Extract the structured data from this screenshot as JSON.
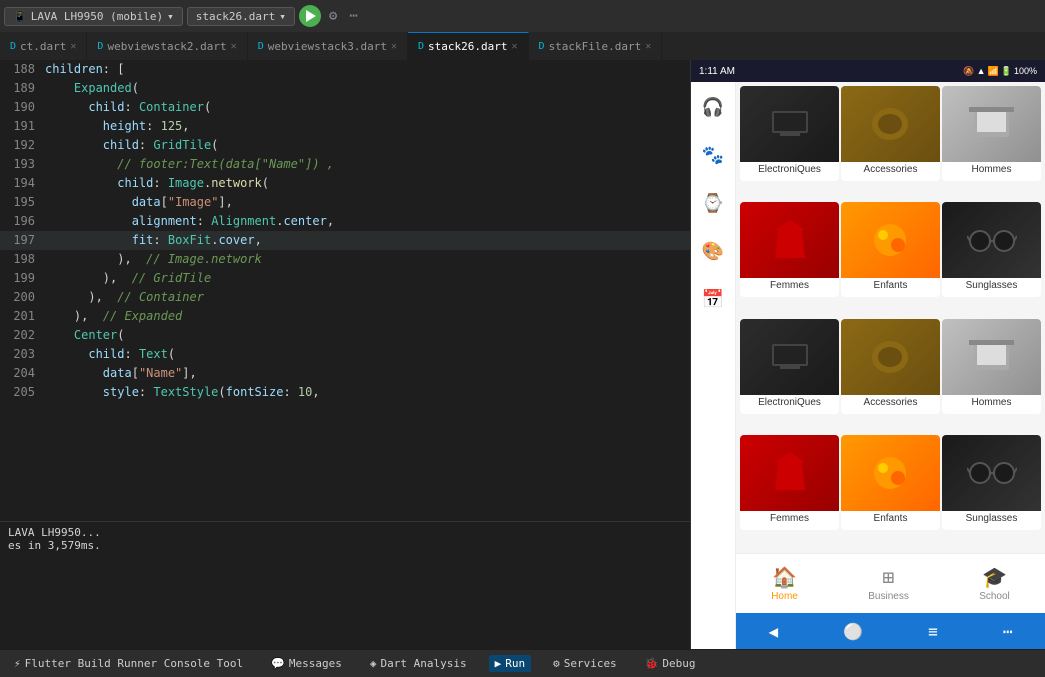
{
  "topbar": {
    "device_label": "LAVA LH9950 (mobile)",
    "stack_label": "stack26.dart"
  },
  "tabs": [
    {
      "id": "ct_dart",
      "label": "ct.dart",
      "active": false,
      "icon": "D"
    },
    {
      "id": "webviewstack2",
      "label": "webviewstack2.dart",
      "active": false,
      "icon": "D"
    },
    {
      "id": "webviewstack3",
      "label": "webviewstack3.dart",
      "active": false,
      "icon": "D"
    },
    {
      "id": "stack26",
      "label": "stack26.dart",
      "active": true,
      "icon": "D"
    },
    {
      "id": "stackFile",
      "label": "stackFile.dart",
      "active": false,
      "icon": "D"
    }
  ],
  "code_lines": [
    {
      "num": "188",
      "content": "  children: [",
      "highlight": false
    },
    {
      "num": "189",
      "content": "    Expanded(",
      "highlight": false
    },
    {
      "num": "190",
      "content": "      child: Container(",
      "highlight": false
    },
    {
      "num": "191",
      "content": "        height: 125,",
      "highlight": false
    },
    {
      "num": "192",
      "content": "        child: GridTile(",
      "highlight": false
    },
    {
      "num": "193",
      "content": "          // footer:Text(data[\"Name\"]) ,",
      "highlight": false
    },
    {
      "num": "194",
      "content": "          child: Image.network(",
      "highlight": false
    },
    {
      "num": "195",
      "content": "            data[\"Image\"],",
      "highlight": false
    },
    {
      "num": "196",
      "content": "            alignment: Alignment.center,",
      "highlight": false
    },
    {
      "num": "197",
      "content": "            fit: BoxFit.cover,",
      "highlight": true
    },
    {
      "num": "198",
      "content": "          ),  // Image.network",
      "highlight": false
    },
    {
      "num": "199",
      "content": "        ),  // GridTile",
      "highlight": false
    },
    {
      "num": "200",
      "content": "      ),  // Container",
      "highlight": false
    },
    {
      "num": "201",
      "content": "    ),  // Expanded",
      "highlight": false
    },
    {
      "num": "202",
      "content": "    Center(",
      "highlight": false
    },
    {
      "num": "203",
      "content": "      child: Text(",
      "highlight": false
    },
    {
      "num": "204",
      "content": "        data[\"Name\"],",
      "highlight": false
    },
    {
      "num": "205",
      "content": "        style: TextStyle(fontSize: 10,",
      "highlight": false
    }
  ],
  "phone": {
    "time": "1:11 AM",
    "battery": "100%",
    "sidebar_icons": [
      "🎧",
      "🐾",
      "⌚",
      "🎨",
      "📅"
    ],
    "grid_items": [
      {
        "label": "ElectroniQues",
        "type": "electronics",
        "emoji": "💻"
      },
      {
        "label": "Accessories",
        "type": "accessories",
        "emoji": "👜"
      },
      {
        "label": "Hommes",
        "type": "hommes",
        "emoji": "🏠"
      },
      {
        "label": "Femmes",
        "type": "femmes",
        "emoji": "👕"
      },
      {
        "label": "Enfants",
        "type": "enfants",
        "emoji": "🧸"
      },
      {
        "label": "Sunglasses",
        "type": "sunglasses",
        "emoji": "🕶️"
      },
      {
        "label": "ElectroniQues",
        "type": "electronics",
        "emoji": "💻"
      },
      {
        "label": "Accessories",
        "type": "accessories",
        "emoji": "👜"
      },
      {
        "label": "Hommes",
        "type": "hommes",
        "emoji": "🏠"
      },
      {
        "label": "Femmes",
        "type": "femmes",
        "emoji": "👕"
      },
      {
        "label": "Enfants",
        "type": "enfants",
        "emoji": "🧸"
      },
      {
        "label": "Sunglasses",
        "type": "sunglasses",
        "emoji": "🕶️"
      }
    ],
    "bottom_nav": [
      {
        "label": "Home",
        "icon": "🏠",
        "active": true
      },
      {
        "label": "Business",
        "icon": "📊",
        "active": false
      },
      {
        "label": "School",
        "icon": "🎓",
        "active": false
      }
    ]
  },
  "console": {
    "lines": [
      "LAVA LH9950...",
      "es in 3,579ms."
    ]
  },
  "bottom_toolbar": {
    "items": [
      {
        "id": "flutter-build",
        "label": "Flutter Build Runner Console Tool",
        "active": false,
        "icon": "⚡"
      },
      {
        "id": "messages",
        "label": "Messages",
        "active": false,
        "icon": "💬"
      },
      {
        "id": "dart-analysis",
        "label": "Dart Analysis",
        "active": false,
        "icon": "◈"
      },
      {
        "id": "run",
        "label": "Run",
        "active": true,
        "icon": "▶"
      },
      {
        "id": "services",
        "label": "Services",
        "active": false,
        "icon": "⚙"
      },
      {
        "id": "debug",
        "label": "Debug",
        "active": false,
        "icon": "🐞"
      }
    ]
  }
}
